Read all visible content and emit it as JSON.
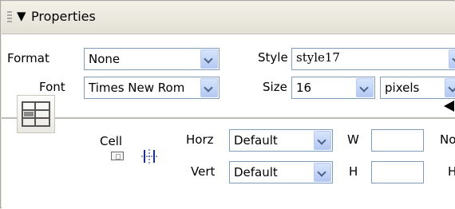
{
  "panel": {
    "title": "Properties"
  },
  "text_row": {
    "format_label": "Format",
    "format_value": "None",
    "style_label": "Style",
    "style_value": "style17",
    "font_label": "Font",
    "font_value": "Times New Rom",
    "size_label": "Size",
    "size_value": "16",
    "unit_value": "pixels"
  },
  "cell_row": {
    "cell_label": "Cell",
    "horz_label": "Horz",
    "horz_value": "Default",
    "vert_label": "Vert",
    "vert_value": "Default",
    "w_label": "W",
    "h_label": "H",
    "w_value": "",
    "h_value": "",
    "no_wrap_label": "No",
    "header_label": "H"
  },
  "icons": {
    "collapse": "triangle-down-icon",
    "table": "table-cell-icon",
    "merge": "merge-cells-icon",
    "split": "split-cell-icon",
    "cursor": "mouse-pointer-icon"
  },
  "colors": {
    "panel_bg": "#ece9d8",
    "field_border": "#7f9db9",
    "dropdown_button": "#b3c8f4"
  }
}
